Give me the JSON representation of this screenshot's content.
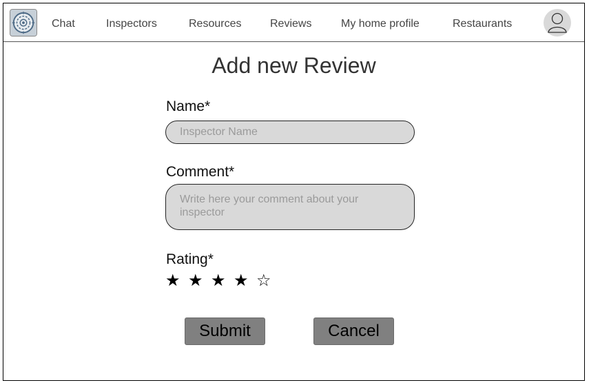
{
  "nav": {
    "items": [
      {
        "label": "Chat"
      },
      {
        "label": "Inspectors"
      },
      {
        "label": "Resources"
      },
      {
        "label": "Reviews"
      },
      {
        "label": "My home profile"
      },
      {
        "label": "Restaurants"
      }
    ]
  },
  "page": {
    "title": "Add new Review"
  },
  "form": {
    "name_label": "Name*",
    "name_placeholder": "Inspector Name",
    "comment_label": "Comment*",
    "comment_placeholder": "Write here your comment about your inspector",
    "rating_label": "Rating*",
    "rating": {
      "value": 4,
      "max": 5,
      "filled_glyph": "★",
      "empty_glyph": "☆"
    },
    "submit_label": "Submit",
    "cancel_label": "Cancel"
  },
  "colors": {
    "button_bg": "#808080",
    "field_bg": "#d9d9d9",
    "avatar_bg": "#d9d9d9"
  },
  "icons": {
    "logo": "app-logo-icon",
    "avatar": "user-avatar-icon"
  }
}
